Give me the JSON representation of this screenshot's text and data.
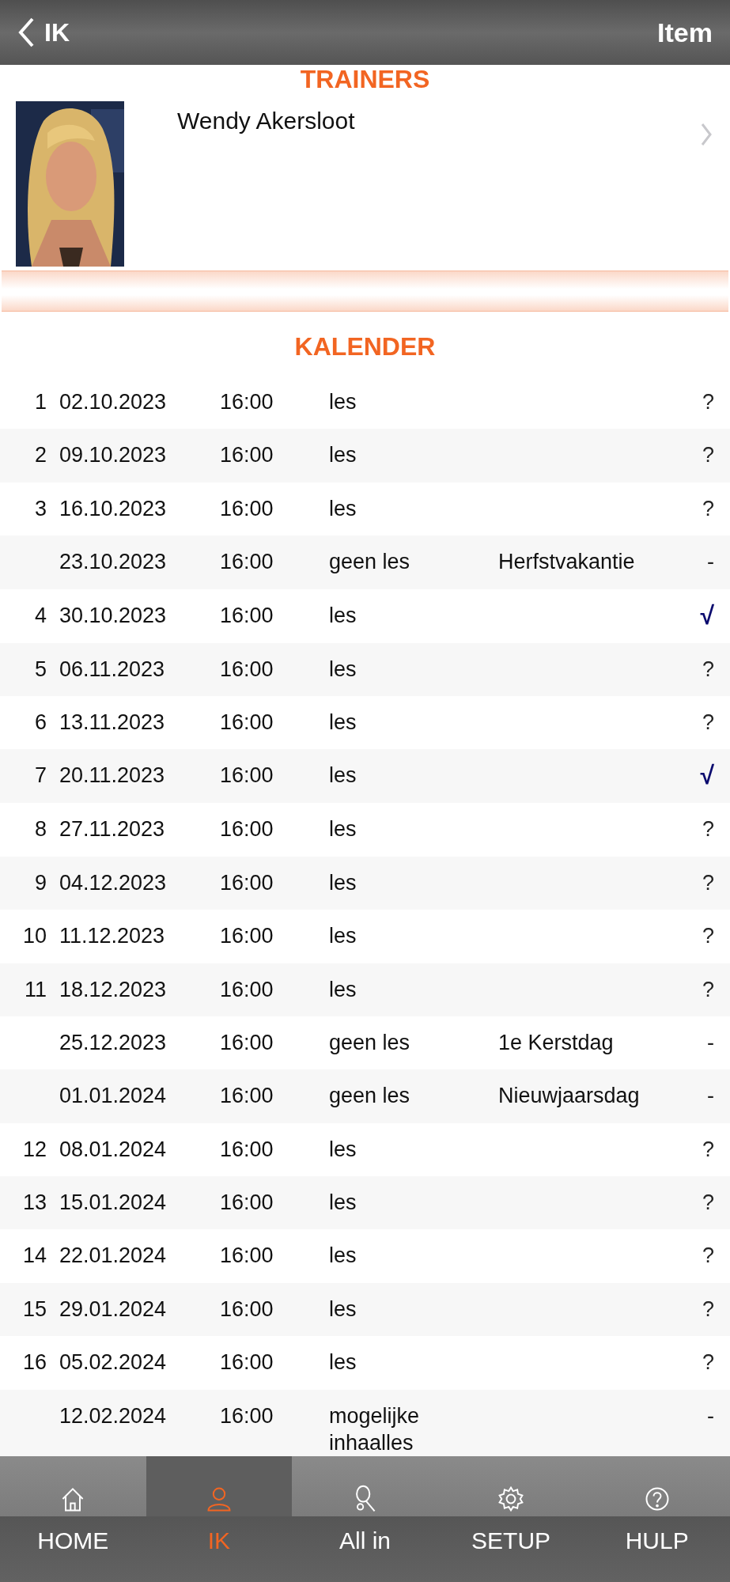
{
  "header": {
    "back_label": "IK",
    "title": "Item"
  },
  "trainers": {
    "title": "TRAINERS",
    "items": [
      {
        "name": "Wendy Akersloot"
      }
    ]
  },
  "calendar": {
    "title": "KALENDER",
    "rows": [
      {
        "number": "1",
        "date": "02.10.2023",
        "time": "16:00",
        "type": "les",
        "status": "?",
        "kind": "open"
      },
      {
        "number": "2",
        "date": "09.10.2023",
        "time": "16:00",
        "type": "les",
        "status": "?",
        "kind": "open"
      },
      {
        "number": "3",
        "date": "16.10.2023",
        "time": "16:00",
        "type": "les",
        "status": "?",
        "kind": "open"
      },
      {
        "date": "23.10.2023",
        "time": "16:00",
        "type": "geen les",
        "note": "Herfstvakantie",
        "status": "-",
        "kind": "none"
      },
      {
        "number": "4",
        "date": "30.10.2023",
        "time": "16:00",
        "type": "les",
        "status": "√",
        "kind": "confirmed"
      },
      {
        "number": "5",
        "date": "06.11.2023",
        "time": "16:00",
        "type": "les",
        "status": "?",
        "kind": "open"
      },
      {
        "number": "6",
        "date": "13.11.2023",
        "time": "16:00",
        "type": "les",
        "status": "?",
        "kind": "open"
      },
      {
        "number": "7",
        "date": "20.11.2023",
        "time": "16:00",
        "type": "les",
        "status": "√",
        "kind": "confirmed"
      },
      {
        "number": "8",
        "date": "27.11.2023",
        "time": "16:00",
        "type": "les",
        "status": "?",
        "kind": "open"
      },
      {
        "number": "9",
        "date": "04.12.2023",
        "time": "16:00",
        "type": "les",
        "status": "?",
        "kind": "open"
      },
      {
        "number": "10",
        "date": "11.12.2023",
        "time": "16:00",
        "type": "les",
        "status": "?",
        "kind": "open"
      },
      {
        "number": "11",
        "date": "18.12.2023",
        "time": "16:00",
        "type": "les",
        "status": "?",
        "kind": "open"
      },
      {
        "date": "25.12.2023",
        "time": "16:00",
        "type": "geen les",
        "note": "1e Kerstdag",
        "status": "-",
        "kind": "none"
      },
      {
        "date": "01.01.2024",
        "time": "16:00",
        "type": "geen les",
        "note": "Nieuwjaarsdag",
        "status": "-",
        "kind": "none"
      },
      {
        "number": "12",
        "date": "08.01.2024",
        "time": "16:00",
        "type": "les",
        "status": "?",
        "kind": "open"
      },
      {
        "number": "13",
        "date": "15.01.2024",
        "time": "16:00",
        "type": "les",
        "status": "?",
        "kind": "open"
      },
      {
        "number": "14",
        "date": "22.01.2024",
        "time": "16:00",
        "type": "les",
        "status": "?",
        "kind": "open"
      },
      {
        "number": "15",
        "date": "29.01.2024",
        "time": "16:00",
        "type": "les",
        "status": "?",
        "kind": "open"
      },
      {
        "number": "16",
        "date": "05.02.2024",
        "time": "16:00",
        "type": "les",
        "status": "?",
        "kind": "open"
      },
      {
        "date": "12.02.2024",
        "time": "16:00",
        "type": "mogelijke inhaalles",
        "status": "-",
        "kind": "none"
      }
    ]
  },
  "nav": [
    {
      "label": "HOME",
      "selected": false
    },
    {
      "label": "IK",
      "selected": true
    },
    {
      "label": "All in",
      "selected": false
    },
    {
      "label": "SETUP",
      "selected": false
    },
    {
      "label": "HULP",
      "selected": false
    }
  ]
}
